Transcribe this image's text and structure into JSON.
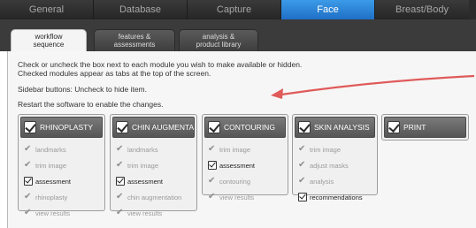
{
  "top_tabs": [
    {
      "label": "General"
    },
    {
      "label": "Database"
    },
    {
      "label": "Capture"
    },
    {
      "label": "Face"
    },
    {
      "label": "Breast/Body"
    }
  ],
  "active_top_tab": "Face",
  "sub_tabs": [
    {
      "line1": "workflow",
      "line2": "sequence"
    },
    {
      "line1": "features &",
      "line2": "assessments"
    },
    {
      "line1": "analysis &",
      "line2": "product library"
    }
  ],
  "instructions": {
    "line1": "Check or uncheck the box next to each module you wish to make available or hidden.",
    "line2": "Checked modules appear as tabs at the top of the screen.",
    "line3": "Sidebar buttons: Uncheck to hide item.",
    "line4": "Restart the software to enable the changes."
  },
  "modules": [
    {
      "title": "RHINOPLASTY",
      "items": [
        {
          "label": "landmarks",
          "kind": "tick"
        },
        {
          "label": "trim image",
          "kind": "tick"
        },
        {
          "label": "assessment",
          "kind": "checkbox"
        },
        {
          "label": "rhinoplasty",
          "kind": "tick"
        },
        {
          "label": "view results",
          "kind": "tick"
        }
      ]
    },
    {
      "title": "CHIN AUGMENTATIO",
      "items": [
        {
          "label": "landmarks",
          "kind": "tick"
        },
        {
          "label": "trim image",
          "kind": "tick"
        },
        {
          "label": "assessment",
          "kind": "checkbox"
        },
        {
          "label": "chin augmentation",
          "kind": "tick"
        },
        {
          "label": "view results",
          "kind": "tick"
        }
      ]
    },
    {
      "title": "CONTOURING",
      "items": [
        {
          "label": "trim image",
          "kind": "tick"
        },
        {
          "label": "assessment",
          "kind": "checkbox"
        },
        {
          "label": "contouring",
          "kind": "tick"
        },
        {
          "label": "view results",
          "kind": "tick"
        }
      ]
    },
    {
      "title": "SKIN ANALYSIS",
      "items": [
        {
          "label": "trim image",
          "kind": "tick"
        },
        {
          "label": "adjust masks",
          "kind": "tick"
        },
        {
          "label": "analysis",
          "kind": "tick"
        },
        {
          "label": "recommendations",
          "kind": "checkbox"
        }
      ]
    },
    {
      "title": "PRINT",
      "items": []
    }
  ],
  "colors": {
    "active_tab": "#2f86d8",
    "arrow": "#e05a5a"
  }
}
